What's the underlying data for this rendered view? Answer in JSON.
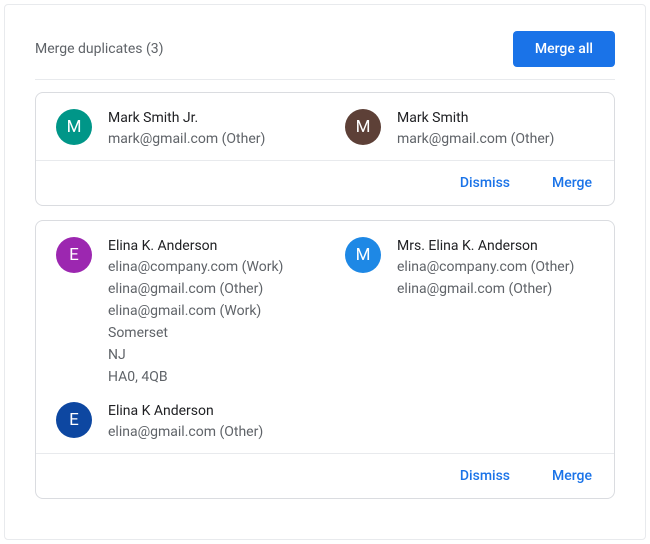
{
  "header": {
    "title": "Merge duplicates (3)",
    "merge_all": "Merge all"
  },
  "actions": {
    "dismiss": "Dismiss",
    "merge": "Merge"
  },
  "groups": [
    {
      "left": [
        {
          "initial": "M",
          "color": "#009688",
          "name": "Mark Smith Jr.",
          "lines": [
            "mark@gmail.com (Other)"
          ]
        }
      ],
      "right": [
        {
          "initial": "M",
          "color": "#5d4037",
          "name": "Mark Smith",
          "lines": [
            "mark@gmail.com (Other)"
          ]
        }
      ]
    },
    {
      "left": [
        {
          "initial": "E",
          "color": "#9c27b0",
          "name": "Elina K. Anderson",
          "lines": [
            "elina@company.com (Work)",
            "elina@gmail.com (Other)",
            "elina@gmail.com (Work)",
            "Somerset",
            "NJ",
            "HA0, 4QB"
          ]
        },
        {
          "initial": "E",
          "color": "#0d47a1",
          "name": "Elina K Anderson",
          "lines": [
            "elina@gmail.com (Other)"
          ]
        }
      ],
      "right": [
        {
          "initial": "M",
          "color": "#1e88e5",
          "name": "Mrs. Elina K. Anderson",
          "lines": [
            "elina@company.com (Other)",
            "elina@gmail.com (Other)"
          ]
        }
      ]
    }
  ]
}
